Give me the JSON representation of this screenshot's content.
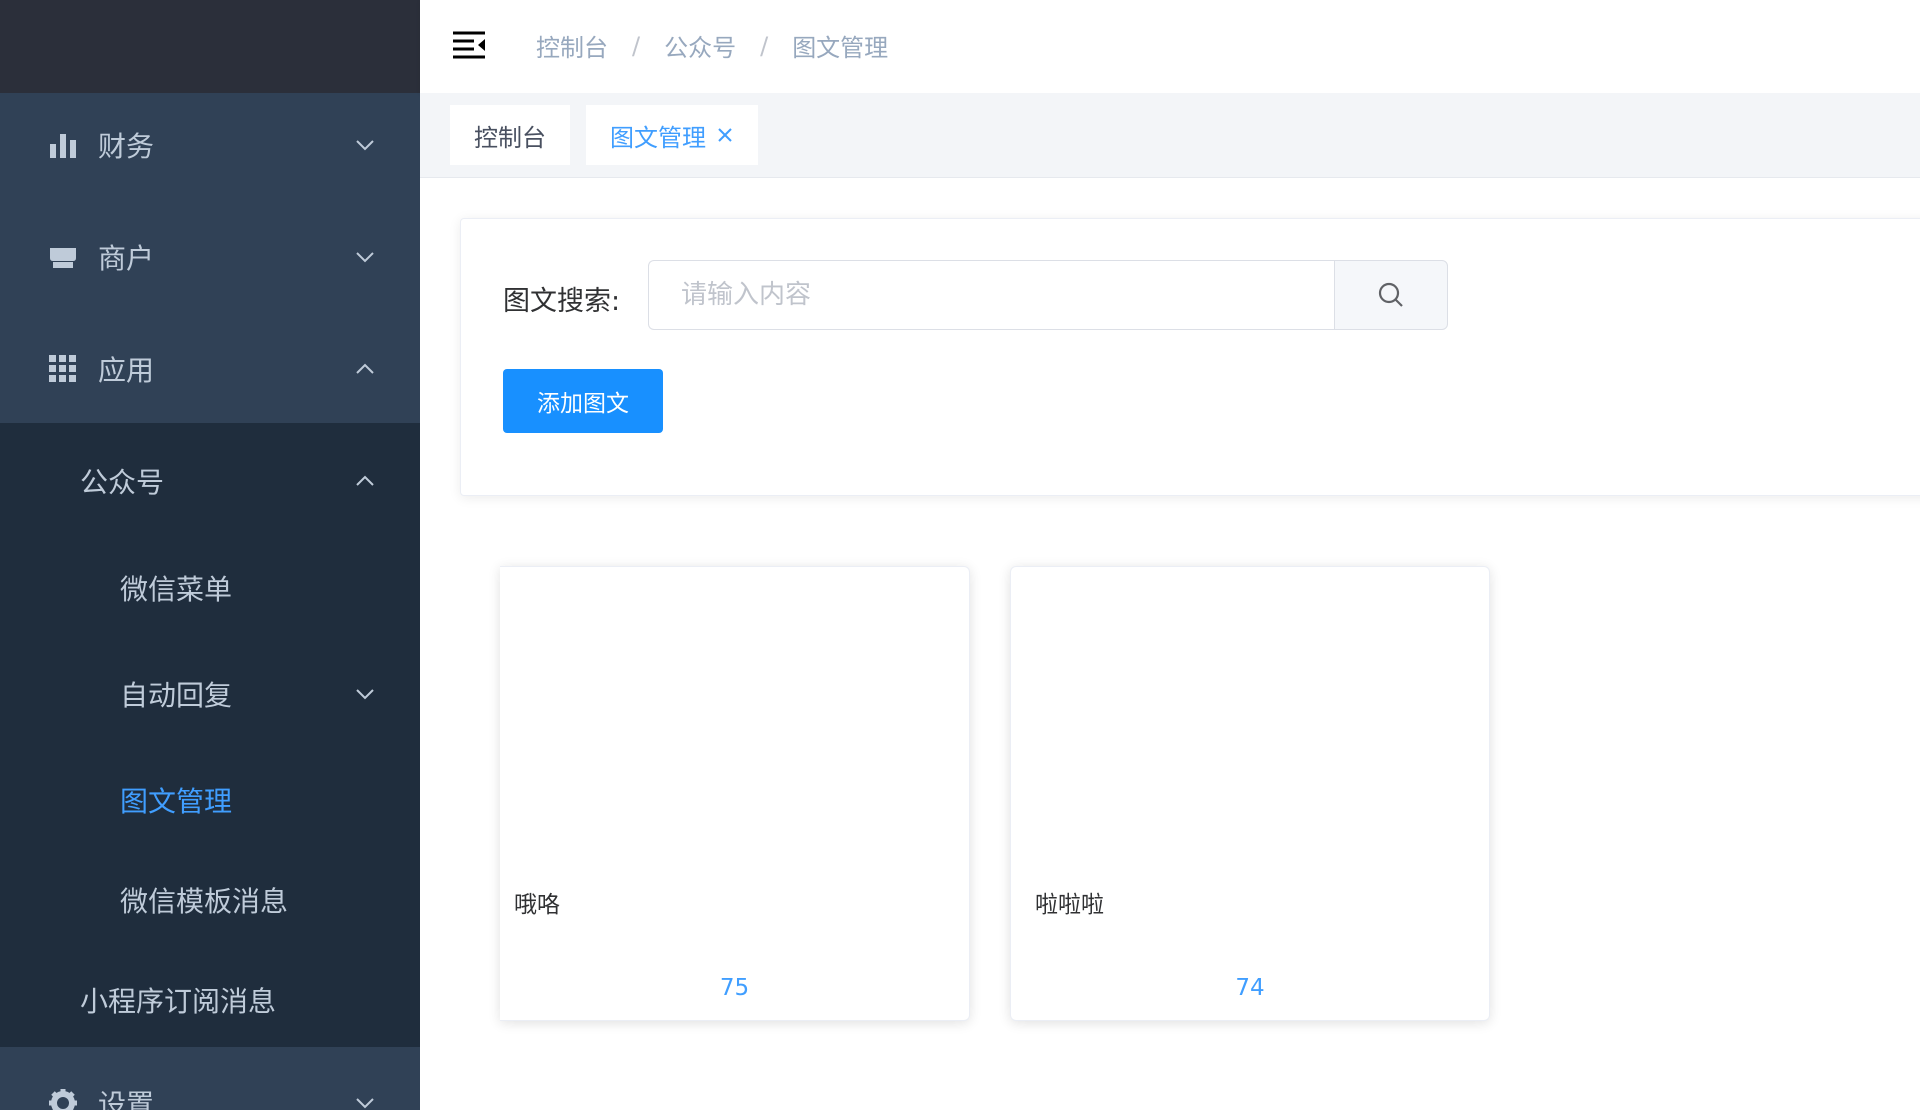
{
  "sidebar": {
    "items": [
      {
        "label": "财务",
        "icon": "bar-chart-icon",
        "expanded": false
      },
      {
        "label": "商户",
        "icon": "shop-icon",
        "expanded": false
      },
      {
        "label": "应用",
        "icon": "grid-icon",
        "expanded": true
      }
    ],
    "submenu": {
      "group_label": "公众号",
      "children": [
        {
          "label": "微信菜单"
        },
        {
          "label": "自动回复"
        },
        {
          "label": "图文管理",
          "active": true
        },
        {
          "label": "微信模板消息"
        }
      ],
      "mini_label": "小程序订阅消息"
    },
    "settings_label": "设置",
    "active_color": "#409eff"
  },
  "header": {
    "breadcrumb": [
      "控制台",
      "公众号",
      "图文管理"
    ],
    "breadcrumb_sep": "/"
  },
  "tags": [
    {
      "label": "控制台",
      "active": false
    },
    {
      "label": "图文管理",
      "active": true
    }
  ],
  "search": {
    "label": "图文搜索:",
    "placeholder": "请输入内容"
  },
  "add_button_label": "添加图文",
  "cards": [
    {
      "title": "哦咯",
      "number": "75"
    },
    {
      "title": "啦啦啦",
      "number": "74"
    }
  ],
  "colors": {
    "sidebar_bg": "#304156",
    "submenu_bg": "#1f2d3d",
    "primary": "#1890ff"
  }
}
